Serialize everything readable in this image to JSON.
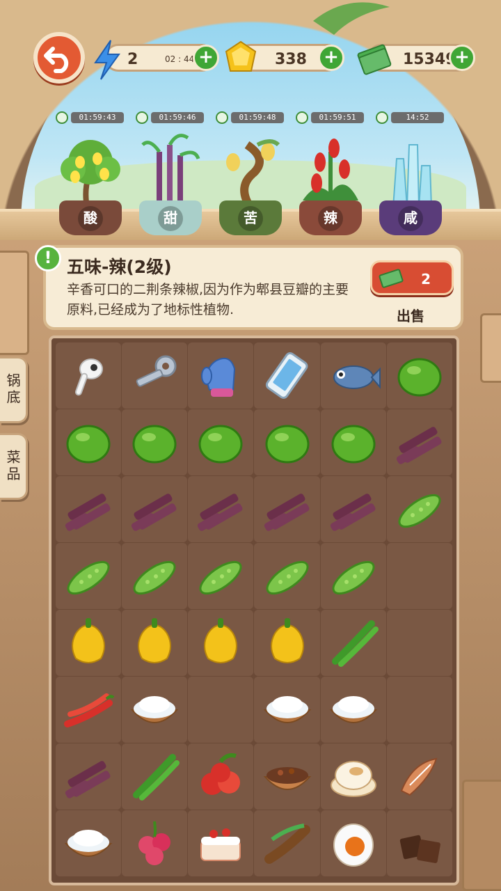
{
  "resources": {
    "energy": {
      "value": "2",
      "timer": "02 : 44",
      "icon": "lightning-icon"
    },
    "gems": {
      "value": "338",
      "icon": "gem-icon"
    },
    "cash": {
      "value": "15349",
      "icon": "cash-icon"
    }
  },
  "plants": [
    {
      "timer": "01:59:43",
      "label": "酸",
      "kind": "lemon-tree",
      "potColor": "#7a4a3a"
    },
    {
      "timer": "01:59:46",
      "label": "甜",
      "kind": "sugarcane",
      "potColor": "#a9cfc9"
    },
    {
      "timer": "01:59:48",
      "label": "苦",
      "kind": "bitter-tree",
      "potColor": "#5b7a3a"
    },
    {
      "timer": "01:59:51",
      "label": "辣",
      "kind": "pepper-plant",
      "potColor": "#8a4a3a"
    },
    {
      "timer": "14:52",
      "label": "咸",
      "kind": "salt-crystal",
      "potColor": "#5a3c7a"
    }
  ],
  "info": {
    "title": "五味-辣(2级)",
    "description": "辛香可口的二荆条辣椒,因为作为郫县豆瓣的主要原料,已经成为了地标性植物.",
    "sell_price": "2",
    "sell_label": "出售"
  },
  "side_tabs": [
    "锅底",
    "菜品"
  ],
  "grid": [
    [
      "earbud",
      "key",
      "mitten",
      "phone",
      "fish",
      "lime"
    ],
    [
      "lime",
      "lime",
      "lime",
      "lime",
      "lime",
      "sugarcane"
    ],
    [
      "sugarcane",
      "sugarcane",
      "sugarcane",
      "sugarcane",
      "sugarcane",
      "bitter-melon"
    ],
    [
      "bitter-melon",
      "bitter-melon",
      "bitter-melon",
      "bitter-melon",
      "bitter-melon",
      ""
    ],
    [
      "yellow-pepper",
      "yellow-pepper",
      "yellow-pepper",
      "yellow-pepper",
      "green-chili",
      ""
    ],
    [
      "red-chili",
      "salt-bowl",
      "",
      "salt-bowl",
      "salt-bowl",
      ""
    ],
    [
      "sugarcane",
      "green-chili",
      "hawthorn",
      "spice-bowl",
      "bun",
      "dried-fish"
    ],
    [
      "salt-bowl",
      "lychee",
      "cake",
      "tamarind",
      "salted-egg",
      "chocolate"
    ]
  ]
}
